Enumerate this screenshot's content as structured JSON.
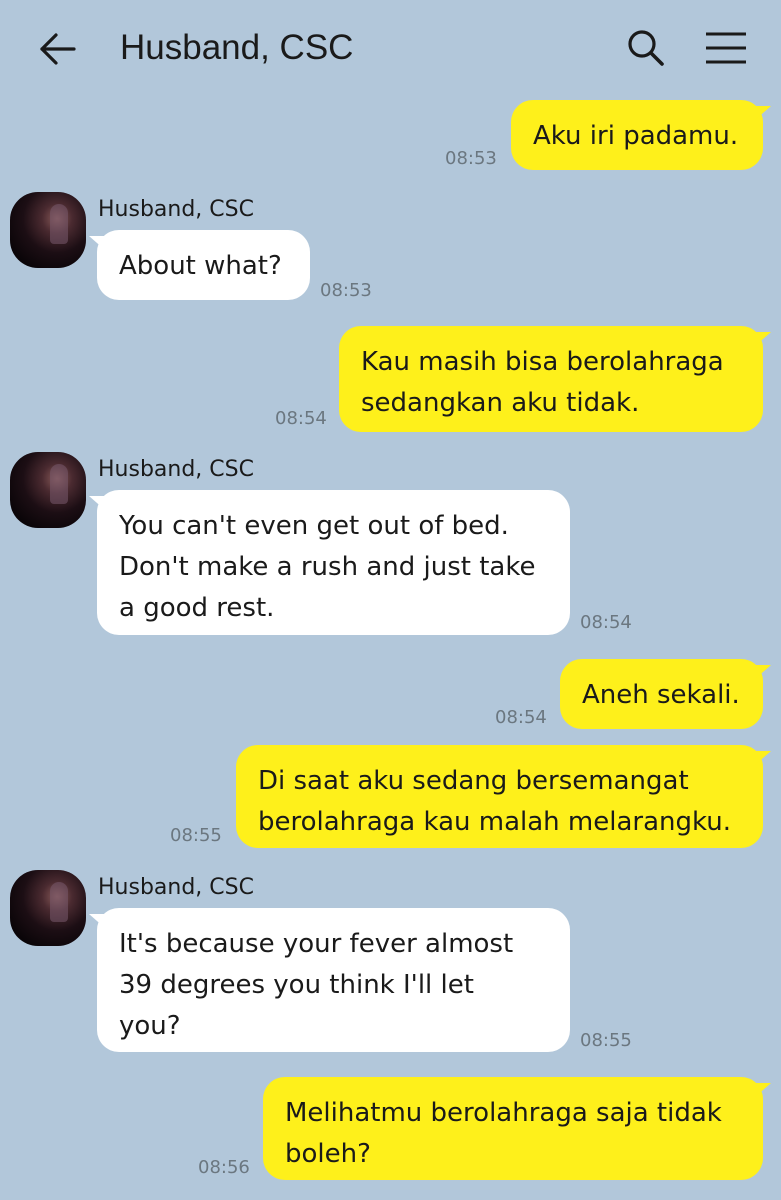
{
  "header": {
    "title": "Husband, CSC",
    "back_icon": "arrow-left-icon",
    "search_icon": "search-icon",
    "menu_icon": "hamburger-menu-icon"
  },
  "colors": {
    "background": "#b2c7da",
    "my_bubble": "#fef01b",
    "their_bubble": "#ffffff"
  },
  "messages": [
    {
      "from": "me",
      "text": "Aku iri padamu.",
      "time": "08:53"
    },
    {
      "from": "them",
      "sender": "Husband, CSC",
      "text": "About what?",
      "time": "08:53"
    },
    {
      "from": "me",
      "text": "Kau masih bisa berolahraga\nsedangkan aku tidak.",
      "time": "08:54"
    },
    {
      "from": "them",
      "sender": "Husband, CSC",
      "text": "You can't even get out of bed.\nDon't make a rush and just take\na good rest.",
      "time": "08:54"
    },
    {
      "from": "me",
      "text": "Aneh sekali.",
      "time": "08:54"
    },
    {
      "from": "me",
      "text": "Di saat aku sedang bersemangat\nberolahraga kau malah melarangku.",
      "time": "08:55"
    },
    {
      "from": "them",
      "sender": "Husband, CSC",
      "text": "It's because your fever almost\n39 degrees you think I'll let\nyou?",
      "time": "08:55"
    },
    {
      "from": "me",
      "text": "Melihatmu berolahraga saja tidak\nboleh?",
      "time": "08:56"
    }
  ]
}
